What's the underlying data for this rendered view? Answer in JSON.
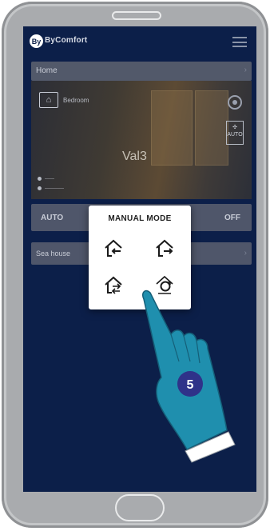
{
  "app": {
    "logo_mark": "By",
    "logo_text": "ByComfort"
  },
  "home_bar": {
    "label": "Home"
  },
  "room": {
    "name": "Bedroom",
    "value": "Val3",
    "fan_label": "AUTO"
  },
  "mode_bar": {
    "auto_label": "AUTO",
    "off_label": "OFF"
  },
  "location_bar": {
    "label": "Sea house"
  },
  "popup": {
    "title": "MANUAL MODE",
    "options": [
      {
        "icon": "home-arrow-in-icon"
      },
      {
        "icon": "home-arrow-out-icon"
      },
      {
        "icon": "home-swap-icon"
      },
      {
        "icon": "home-cycle-icon"
      }
    ]
  },
  "step_badge": {
    "number": "5",
    "color": "#2f3289"
  },
  "colors": {
    "screen_bg": "#0c1f49",
    "hand": "#1f8fae",
    "frame": "#a9abae"
  }
}
